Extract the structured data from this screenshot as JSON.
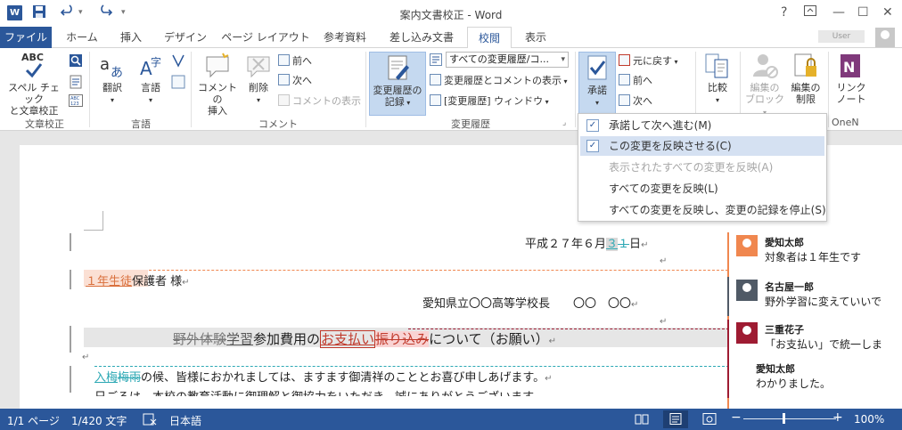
{
  "titlebar": {
    "title": "案内文書校正 - Word",
    "help": "?",
    "restore_icon": "ribbon-display-icon",
    "minimize": "—",
    "maximize": "☐",
    "close": "✕",
    "logo": "W"
  },
  "tabs": [
    {
      "label": "ファイル"
    },
    {
      "label": "ホーム"
    },
    {
      "label": "挿入"
    },
    {
      "label": "デザイン"
    },
    {
      "label": "ページ レイアウト"
    },
    {
      "label": "参考資料"
    },
    {
      "label": "差し込み文書"
    },
    {
      "label": "校閲"
    },
    {
      "label": "表示"
    }
  ],
  "user": {
    "name": "User"
  },
  "ribbon": {
    "proofing": {
      "group_label": "文章校正",
      "spell_label_1": "スペル チェック",
      "spell_label_2": "と文章校正",
      "abc": "ABC"
    },
    "language": {
      "group_label": "言語",
      "translate": "翻訳",
      "language": "言語"
    },
    "comments": {
      "group_label": "コメント",
      "new_comment_1": "コメントの",
      "new_comment_2": "挿入",
      "delete": "削除",
      "prev": "前へ",
      "next": "次へ",
      "show_comments": "コメントの表示"
    },
    "tracking": {
      "group_label": "変更履歴",
      "track_1": "変更履歴の",
      "track_2": "記録",
      "markup_select": "すべての変更履歴/コ...",
      "show_markup": "変更履歴とコメントの表示",
      "reviewing_pane": "[変更履歴] ウィンドウ"
    },
    "changes": {
      "accept": "承諾",
      "reject": "元に戻す",
      "prev": "前へ",
      "next": "次へ"
    },
    "compare": {
      "label": "比較"
    },
    "protect": {
      "block_1": "編集の",
      "block_2": "ブロック",
      "restrict_1": "編集の",
      "restrict_2": "制限"
    },
    "onenote": {
      "link_1": "リンク",
      "link_2": "ノート",
      "group_label": "OneN"
    }
  },
  "menu": {
    "items": [
      {
        "label": "承諾して次へ進む(M)",
        "state": "normal"
      },
      {
        "label": "この変更を反映させる(C)",
        "state": "hover"
      },
      {
        "label": "表示されたすべての変更を反映(A)",
        "state": "disabled"
      },
      {
        "label": "すべての変更を反映(L)",
        "state": "normal"
      },
      {
        "label": "すべての変更を反映し、変更の記録を停止(S)",
        "state": "normal"
      }
    ]
  },
  "document": {
    "date_prefix": "平成２７年６月",
    "date_ins": "３",
    "date_del": "１",
    "date_suffix": "日",
    "addressee_ins": "１年生徒",
    "addressee_rest": "保護者 様",
    "sender": "愛知県立〇〇高等学校長　　〇〇　〇〇",
    "subject_del": "野外体験",
    "subject_ins": "学習",
    "subject_mid": "参加費用の",
    "subject_ins2": "お支払い",
    "subject_del2": "振り込み",
    "subject_end": "について（お願い）",
    "body_ins": "入梅",
    "body_del": "梅雨",
    "body_rest": "の候、皆様におかれましては、ますます御清祥のこととお喜び申しあげます。",
    "body_line2": "日ごろは、本校の教育活動に御理解と御協力をいただき、誠にありがとうございます。",
    "pilcrow": "↵"
  },
  "comments": [
    {
      "author": "愛知太郎",
      "text": "対象者は１年生です",
      "color": "#f0874f"
    },
    {
      "author": "名古屋一郎",
      "text": "野外学習に変えていいで",
      "color": "#505a66"
    },
    {
      "author": "三重花子",
      "text": "「お支払い」で統一しま",
      "color": "#9e1b32"
    },
    {
      "author": "愛知太郎",
      "text": "わかりました。",
      "color": "#9e1b32"
    }
  ],
  "statusbar": {
    "page": "1/1 ページ",
    "words": "1/420 文字",
    "language": "日本語",
    "zoom": "100%",
    "zoom_minus": "−",
    "zoom_plus": "+"
  },
  "colors": {
    "accent": "#2b579a",
    "menu_hover": "#d5e1f2"
  }
}
